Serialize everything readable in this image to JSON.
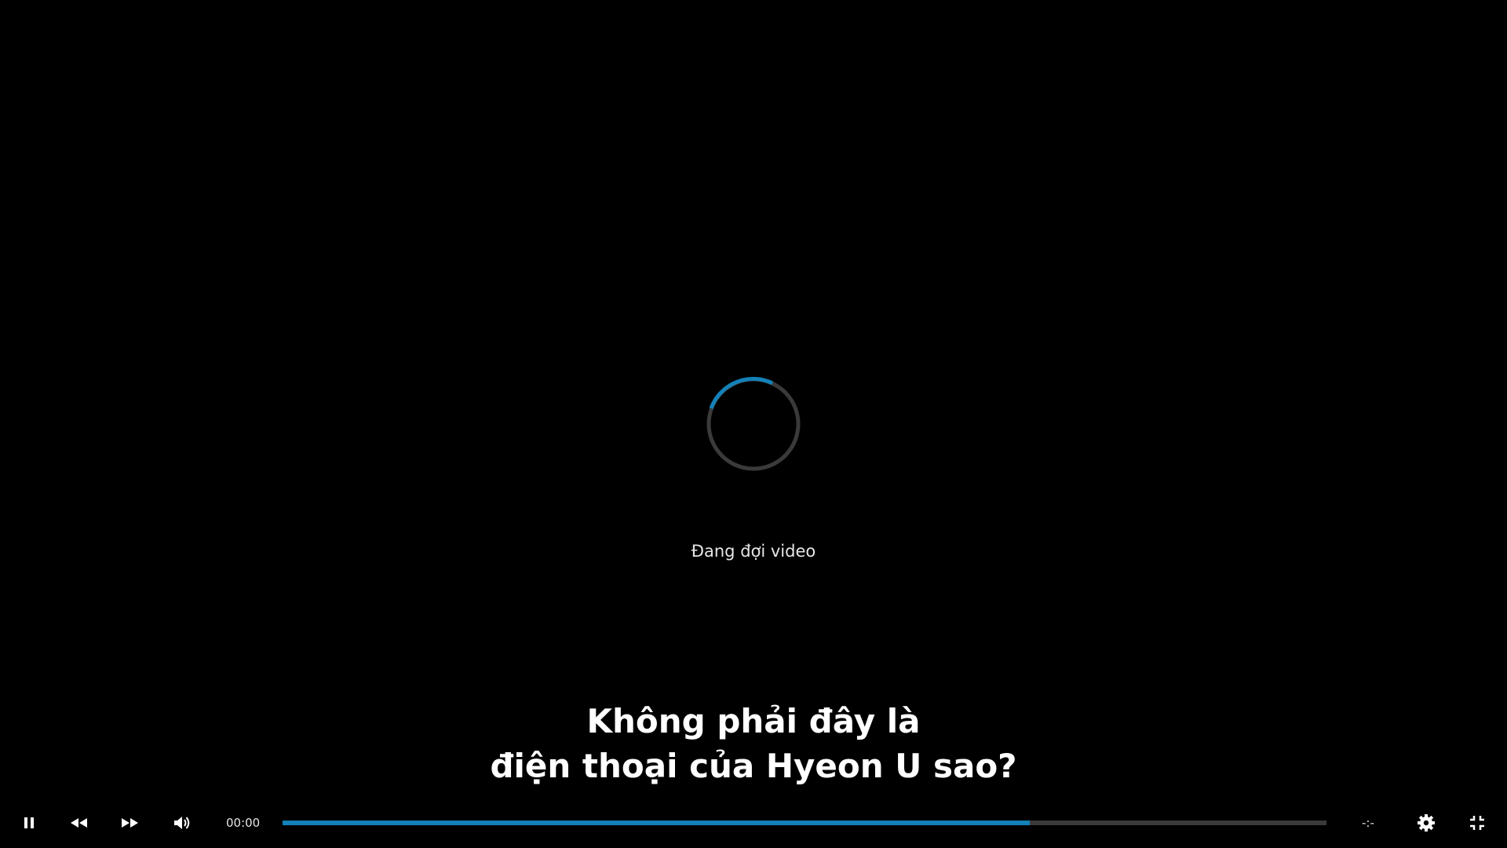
{
  "loading": {
    "text": "Đang đợi video",
    "spinner_track_color": "#3a3a3a",
    "spinner_arc_color": "#1481b8"
  },
  "subtitle": {
    "line1": "Không phải đây là",
    "line2": "điện thoại của Hyeon U sao?"
  },
  "controls": {
    "play_pause_icon": "pause-icon",
    "rewind_icon": "rewind-icon",
    "fast_forward_icon": "fast-forward-icon",
    "volume_icon": "volume-icon",
    "current_time": "00:00",
    "remaining_time": "-:-",
    "settings_icon": "gear-icon",
    "fullscreen_icon": "exit-fullscreen-icon",
    "progress_fraction": 0.716,
    "progress_color": "#1481b8",
    "progress_track_color": "#3a3a3a"
  }
}
